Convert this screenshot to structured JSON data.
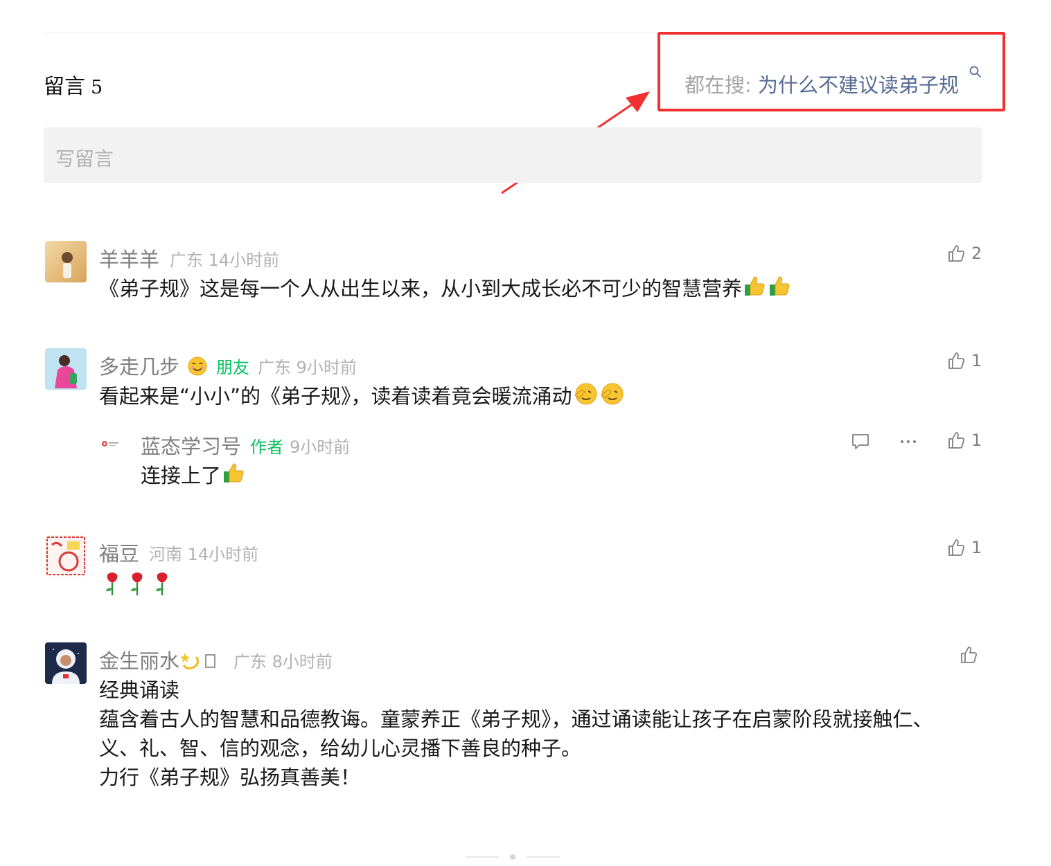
{
  "header": {
    "title": "留言",
    "count": "5"
  },
  "search_hint": {
    "prefix": "都在搜: ",
    "term": "为什么不建议读弟子规"
  },
  "write_placeholder": "写留言",
  "comments": [
    {
      "name": "羊羊羊",
      "location": "广东",
      "time": "14小时前",
      "likes": "2",
      "text": "《弟子规》这是每一个人从出生以来，从小到大成长必不可少的智慧营养"
    },
    {
      "name": "多走几步",
      "badge": "朋友",
      "location": "广东",
      "time": "9小时前",
      "likes": "1",
      "text": "看起来是“小小”的《弟子规》，读着读着竟会暖流涌动",
      "reply": {
        "name": "蓝态学习号",
        "badge": "作者",
        "time": "9小时前",
        "likes": "1",
        "text": "连接上了"
      }
    },
    {
      "name": "福豆",
      "location": "河南",
      "time": "14小时前",
      "likes": "1",
      "text": ""
    },
    {
      "name": "金生丽水",
      "location": "广东",
      "time": "8小时前",
      "likes": "",
      "lines": [
        "经典诵读",
        "蕴含着古人的智慧和品德教诲。童蒙养正《弟子规》，通过诵读能让孩子在启蒙阶段就接触仁、",
        "义、礼、智、信的观念，给幼儿心灵播下善良的种子。",
        "力行《弟子规》弘扬真善美！"
      ]
    }
  ],
  "colors": {
    "highlight": "#f23030",
    "link": "#576b95",
    "friend": "#07c160"
  }
}
